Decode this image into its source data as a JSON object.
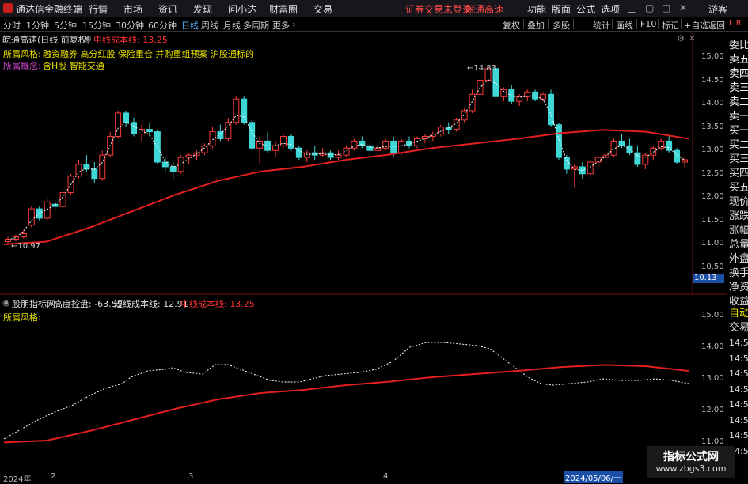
{
  "menu": {
    "app_title": "通达信金融终端",
    "items": [
      "行情",
      "市场",
      "资讯",
      "发现",
      "问小达",
      "财富圈",
      "交易"
    ],
    "notice": "证券交易未登录",
    "notice2": "皖通高速",
    "right_items": [
      "功能",
      "版面",
      "公式",
      "选项"
    ],
    "user": "游客"
  },
  "toolbar": {
    "periods": [
      "分时",
      "1分钟",
      "5分钟",
      "15分钟",
      "30分钟",
      "60分钟",
      "日线",
      "周线",
      "月线",
      "多周期",
      "更多"
    ],
    "active_period": "日线",
    "right": [
      "复权",
      "叠加",
      "多股",
      "统计",
      "画线",
      "F10",
      "标记",
      "+自选",
      "返回"
    ]
  },
  "main_info": {
    "stock": "皖通高速(日线 前复权)",
    "indicator": "中线成本线: 13.25",
    "style_label": "所属风格:",
    "style_value": "融资融券 高分红股 保险重仓 并购重组预案 沪股通标的",
    "concept_label": "所属概念:",
    "concept_value": "含H股 智能交通",
    "high_label": "14.83",
    "low_label": "10.97",
    "price_tag": "10.13"
  },
  "sub_info": {
    "title": "股朋指标网",
    "height_label": "高度控盘: -63.55",
    "short_label": "短线成本线: 12.91",
    "mid_label": "中线成本线: 13.25",
    "style_label": "所属风格:"
  },
  "main_axis": [
    "15.00",
    "14.50",
    "14.00",
    "13.50",
    "13.00",
    "12.50",
    "12.00",
    "11.50",
    "11.00",
    "10.50"
  ],
  "sub_axis": [
    "15.00",
    "14.00",
    "13.00",
    "12.00",
    "11.00"
  ],
  "right_panel": {
    "top_items": [
      "委比",
      "卖五",
      "卖四",
      "卖三",
      "卖二",
      "卖一",
      "买一",
      "买二",
      "买三",
      "买四",
      "买五",
      "现价",
      "涨跌",
      "涨幅",
      "总量",
      "外盘",
      "换手",
      "净资",
      "收益"
    ],
    "bottom_items": [
      "自动",
      "交易"
    ],
    "times": [
      "14:56",
      "14:56",
      "14:56",
      "14:56",
      "14:56",
      "14:56",
      "14:56",
      "14:56"
    ],
    "corner": "L R"
  },
  "time_axis": {
    "labels": [
      "2024年",
      "2",
      "3",
      "4"
    ],
    "cursor_date": "2024/05/06/一"
  },
  "watermark": {
    "title": "指标公式网",
    "url": "www.zbgs3.com"
  },
  "chart_data": {
    "type": "candlestick",
    "ylim": [
      10.5,
      15.2
    ],
    "n_candles": 87,
    "mid_cost_line": [
      [
        0,
        10.99
      ],
      [
        10,
        11.05
      ],
      [
        20,
        11.35
      ],
      [
        30,
        11.7
      ],
      [
        40,
        12.05
      ],
      [
        50,
        12.35
      ],
      [
        60,
        12.55
      ],
      [
        70,
        12.65
      ],
      [
        80,
        12.8
      ],
      [
        90,
        12.91
      ],
      [
        100,
        13.05
      ],
      [
        110,
        13.15
      ],
      [
        120,
        13.25
      ],
      [
        130,
        13.37
      ],
      [
        140,
        13.44
      ],
      [
        150,
        13.4
      ],
      [
        160,
        13.25
      ]
    ],
    "candles": [
      [
        11.05,
        11.15,
        11.0,
        11.1
      ],
      [
        11.1,
        11.2,
        11.05,
        11.15
      ],
      [
        11.15,
        11.3,
        11.12,
        11.22
      ],
      [
        11.4,
        11.8,
        11.35,
        11.75
      ],
      [
        11.75,
        11.8,
        11.5,
        11.55
      ],
      [
        11.55,
        12.0,
        11.5,
        11.9
      ],
      [
        11.85,
        11.95,
        11.7,
        11.8
      ],
      [
        11.8,
        12.2,
        11.75,
        12.1
      ],
      [
        12.1,
        12.5,
        12.05,
        12.45
      ],
      [
        12.45,
        12.8,
        12.4,
        12.7
      ],
      [
        12.7,
        12.9,
        12.55,
        12.6
      ],
      [
        12.6,
        12.75,
        12.3,
        12.4
      ],
      [
        12.4,
        13.0,
        12.35,
        12.9
      ],
      [
        12.9,
        13.4,
        12.85,
        13.3
      ],
      [
        13.3,
        13.85,
        13.25,
        13.8
      ],
      [
        13.8,
        13.85,
        13.5,
        13.6
      ],
      [
        13.6,
        13.7,
        13.3,
        13.35
      ],
      [
        13.35,
        13.55,
        13.2,
        13.45
      ],
      [
        13.45,
        13.6,
        13.3,
        13.4
      ],
      [
        13.4,
        13.45,
        12.7,
        12.75
      ],
      [
        12.75,
        12.85,
        12.55,
        12.65
      ],
      [
        12.65,
        12.75,
        12.4,
        12.55
      ],
      [
        12.55,
        12.9,
        12.5,
        12.85
      ],
      [
        12.85,
        12.95,
        12.7,
        12.9
      ],
      [
        12.9,
        13.0,
        12.8,
        12.95
      ],
      [
        12.95,
        13.15,
        12.9,
        13.1
      ],
      [
        13.1,
        13.5,
        13.05,
        13.4
      ],
      [
        13.4,
        13.55,
        13.2,
        13.25
      ],
      [
        13.25,
        13.7,
        13.2,
        13.6
      ],
      [
        13.6,
        14.15,
        13.55,
        14.1
      ],
      [
        14.1,
        14.15,
        13.55,
        13.6
      ],
      [
        13.6,
        13.65,
        13.0,
        13.05
      ],
      [
        13.05,
        13.3,
        12.7,
        13.2
      ],
      [
        13.2,
        13.4,
        12.95,
        13.0
      ],
      [
        13.0,
        13.2,
        12.85,
        13.1
      ],
      [
        13.1,
        13.35,
        13.05,
        13.3
      ],
      [
        13.3,
        13.35,
        13.0,
        13.05
      ],
      [
        13.05,
        13.1,
        12.8,
        12.85
      ],
      [
        12.85,
        13.0,
        12.75,
        12.95
      ],
      [
        12.95,
        13.1,
        12.8,
        12.9
      ],
      [
        12.9,
        13.05,
        12.85,
        12.95
      ],
      [
        12.95,
        13.0,
        12.8,
        12.85
      ],
      [
        12.85,
        13.0,
        12.8,
        12.9
      ],
      [
        12.9,
        13.1,
        12.85,
        13.05
      ],
      [
        13.05,
        13.25,
        13.0,
        13.2
      ],
      [
        13.2,
        13.3,
        13.05,
        13.1
      ],
      [
        13.1,
        13.2,
        12.95,
        13.0
      ],
      [
        13.0,
        13.1,
        12.9,
        13.05
      ],
      [
        13.05,
        13.25,
        13.0,
        13.2
      ],
      [
        13.2,
        13.3,
        12.85,
        12.95
      ],
      [
        12.95,
        13.25,
        12.9,
        13.2
      ],
      [
        13.2,
        13.3,
        13.05,
        13.1
      ],
      [
        13.1,
        13.3,
        13.05,
        13.25
      ],
      [
        13.25,
        13.35,
        13.15,
        13.3
      ],
      [
        13.3,
        13.4,
        13.2,
        13.35
      ],
      [
        13.35,
        13.55,
        13.3,
        13.5
      ],
      [
        13.5,
        13.6,
        13.35,
        13.45
      ],
      [
        13.45,
        13.7,
        13.4,
        13.65
      ],
      [
        13.65,
        13.9,
        13.6,
        13.85
      ],
      [
        13.85,
        14.3,
        13.8,
        14.2
      ],
      [
        14.2,
        14.6,
        14.15,
        14.5
      ],
      [
        14.5,
        14.83,
        14.4,
        14.75
      ],
      [
        14.75,
        14.8,
        14.1,
        14.15
      ],
      [
        14.15,
        14.35,
        14.05,
        14.3
      ],
      [
        14.3,
        14.4,
        14.0,
        14.05
      ],
      [
        14.05,
        14.2,
        13.95,
        14.15
      ],
      [
        14.15,
        14.3,
        14.05,
        14.25
      ],
      [
        14.25,
        14.3,
        14.05,
        14.1
      ],
      [
        14.1,
        14.25,
        14.05,
        14.2
      ],
      [
        14.2,
        14.3,
        13.5,
        13.55
      ],
      [
        13.55,
        13.6,
        12.8,
        12.85
      ],
      [
        12.85,
        12.9,
        12.5,
        12.6
      ],
      [
        12.6,
        12.7,
        12.2,
        12.65
      ],
      [
        12.65,
        12.75,
        12.4,
        12.5
      ],
      [
        12.5,
        12.8,
        12.4,
        12.75
      ],
      [
        12.75,
        12.9,
        12.6,
        12.85
      ],
      [
        12.85,
        13.0,
        12.7,
        12.9
      ],
      [
        12.9,
        13.25,
        12.85,
        13.2
      ],
      [
        13.2,
        13.35,
        13.05,
        13.1
      ],
      [
        13.1,
        13.25,
        12.9,
        12.95
      ],
      [
        12.95,
        13.1,
        12.65,
        12.7
      ],
      [
        12.7,
        12.95,
        12.6,
        12.9
      ],
      [
        12.9,
        13.1,
        12.8,
        13.05
      ],
      [
        13.05,
        13.25,
        13.0,
        13.2
      ],
      [
        13.2,
        13.3,
        12.95,
        13.0
      ],
      [
        13.0,
        13.05,
        12.7,
        12.75
      ],
      [
        12.75,
        12.85,
        12.65,
        12.8
      ]
    ],
    "sub_ylim": [
      10.9,
      15.1
    ],
    "sub_short_line": [
      [
        0,
        11.1
      ],
      [
        4,
        11.4
      ],
      [
        8,
        11.7
      ],
      [
        12,
        11.95
      ],
      [
        16,
        12.15
      ],
      [
        20,
        12.45
      ],
      [
        24,
        12.7
      ],
      [
        28,
        12.85
      ],
      [
        30,
        13.05
      ],
      [
        34,
        13.25
      ],
      [
        38,
        13.3
      ],
      [
        40,
        13.35
      ],
      [
        43,
        13.2
      ],
      [
        47,
        13.15
      ],
      [
        50,
        13.45
      ],
      [
        53,
        13.45
      ],
      [
        56,
        13.3
      ],
      [
        60,
        13.1
      ],
      [
        63,
        12.95
      ],
      [
        66,
        12.9
      ],
      [
        70,
        12.9
      ],
      [
        73,
        13.0
      ],
      [
        76,
        13.1
      ],
      [
        80,
        13.15
      ],
      [
        84,
        13.2
      ],
      [
        88,
        13.3
      ],
      [
        92,
        13.55
      ],
      [
        96,
        14.0
      ],
      [
        100,
        14.15
      ],
      [
        104,
        14.15
      ],
      [
        108,
        14.1
      ],
      [
        112,
        14.05
      ],
      [
        115,
        13.95
      ],
      [
        118,
        13.65
      ],
      [
        121,
        13.35
      ],
      [
        124,
        13.05
      ],
      [
        127,
        12.85
      ],
      [
        130,
        12.8
      ],
      [
        134,
        12.85
      ],
      [
        138,
        12.9
      ],
      [
        142,
        13.0
      ],
      [
        146,
        12.95
      ],
      [
        150,
        12.95
      ],
      [
        154,
        13.0
      ],
      [
        158,
        12.95
      ],
      [
        162,
        12.85
      ]
    ],
    "sub_mid_line": [
      [
        0,
        10.99
      ],
      [
        10,
        11.05
      ],
      [
        20,
        11.35
      ],
      [
        30,
        11.7
      ],
      [
        40,
        12.05
      ],
      [
        50,
        12.35
      ],
      [
        60,
        12.55
      ],
      [
        70,
        12.65
      ],
      [
        80,
        12.8
      ],
      [
        90,
        12.91
      ],
      [
        100,
        13.05
      ],
      [
        110,
        13.15
      ],
      [
        120,
        13.25
      ],
      [
        130,
        13.37
      ],
      [
        140,
        13.44
      ],
      [
        150,
        13.4
      ],
      [
        160,
        13.25
      ]
    ]
  }
}
